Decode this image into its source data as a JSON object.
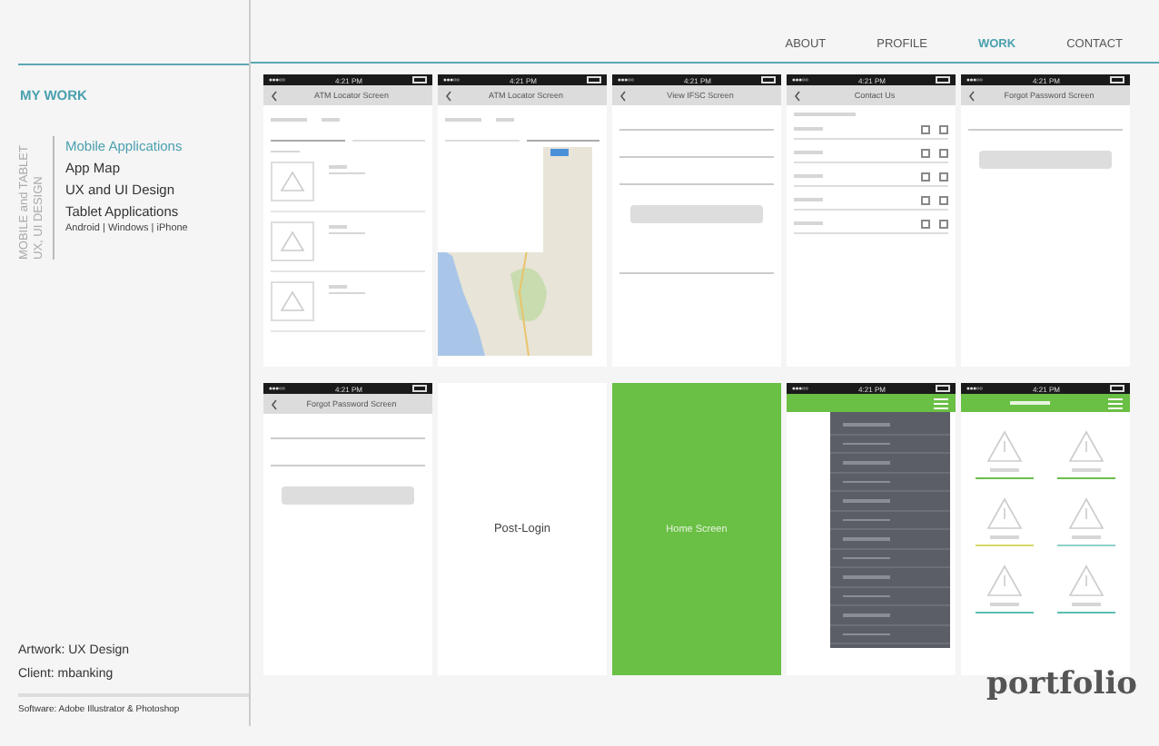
{
  "nav": [
    {
      "label": "ABOUT",
      "selected": false
    },
    {
      "label": "PROFILE",
      "selected": false
    },
    {
      "label": "WORK",
      "selected": true
    },
    {
      "label": "CONTACT",
      "selected": false
    }
  ],
  "sidebar": {
    "heading": "MY WORK",
    "category": [
      "MOBILE and TABLET",
      "UX, UI DESIGN"
    ],
    "items": [
      {
        "label": "Mobile Applications",
        "selected": true
      },
      {
        "label": "App Map",
        "selected": false
      },
      {
        "label": "UX and UI Design",
        "selected": false
      },
      {
        "label": "Tablet Applications",
        "selected": false
      }
    ],
    "platforms": "Android | Windows | iPhone"
  },
  "credits": {
    "artwork": "Artwork: UX Design",
    "client": "Client: mbanking",
    "software": "Software: Adobe Illustrator & Photoshop"
  },
  "screens": [
    {
      "kind": "list",
      "time": "4:21 PM",
      "title": "ATM Locator Screen"
    },
    {
      "kind": "map",
      "time": "4:21 PM",
      "title": "ATM Locator Screen"
    },
    {
      "kind": "form",
      "time": "4:21 PM",
      "title": "View IFSC Screen"
    },
    {
      "kind": "contacts",
      "time": "4:21 PM",
      "title": "Contact Us"
    },
    {
      "kind": "forgot",
      "time": "4:21 PM",
      "title": "Forgot Password Screen"
    },
    {
      "kind": "reset",
      "time": "4:21 PM",
      "title": "Forgot Password Screen"
    },
    {
      "kind": "blank",
      "title": "Post-Login"
    },
    {
      "kind": "splash",
      "title": "Home Screen"
    },
    {
      "kind": "menu",
      "time": "4:21 PM"
    },
    {
      "kind": "dashboard",
      "time": "4:21 PM",
      "tiles": [
        {
          "color": "#6abf4b"
        },
        {
          "color": "#6abf4b"
        },
        {
          "color": "#d8d86a"
        },
        {
          "color": "#8fd0c8"
        },
        {
          "color": "#5bbfb0"
        },
        {
          "color": "#5bbfb0"
        }
      ]
    }
  ],
  "logo": "portfolio"
}
